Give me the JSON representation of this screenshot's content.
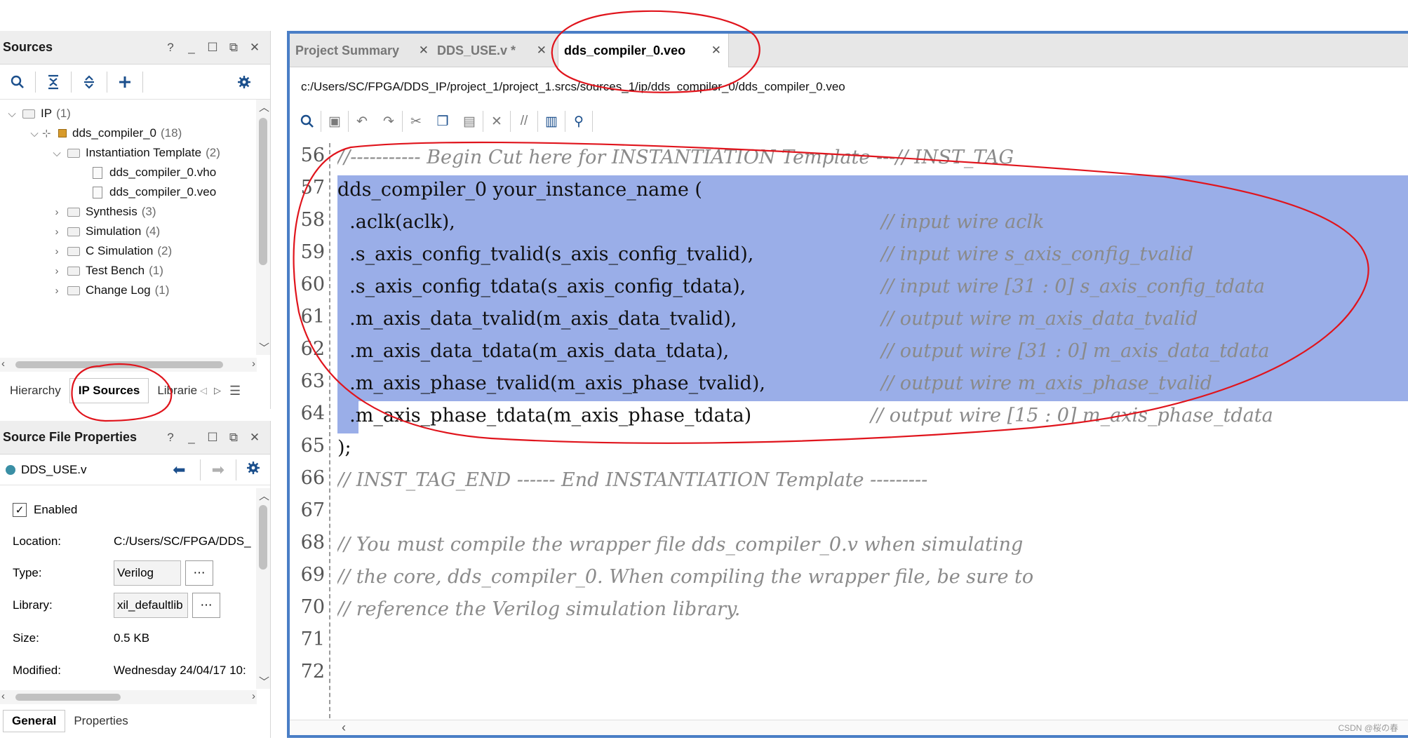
{
  "sources_panel": {
    "title": "Sources",
    "controls": [
      "?",
      "_",
      "☐",
      "⧉",
      "✕"
    ],
    "tree": [
      {
        "label": "IP",
        "count": "(1)"
      },
      {
        "label": "dds_compiler_0",
        "count": "(18)"
      },
      {
        "label": "Instantiation Template",
        "count": "(2)"
      },
      {
        "label": "dds_compiler_0.vho",
        "count": ""
      },
      {
        "label": "dds_compiler_0.veo",
        "count": ""
      },
      {
        "label": "Synthesis",
        "count": "(3)"
      },
      {
        "label": "Simulation",
        "count": "(4)"
      },
      {
        "label": "C Simulation",
        "count": "(2)"
      },
      {
        "label": "Test Bench",
        "count": "(1)"
      },
      {
        "label": "Change Log",
        "count": "(1)"
      }
    ],
    "tabs": [
      "Hierarchy",
      "IP Sources",
      "Librarie"
    ]
  },
  "properties_panel": {
    "title": "Source File Properties",
    "file": "DDS_USE.v",
    "enabled_label": "Enabled",
    "rows": [
      {
        "label": "Location:",
        "value": "C:/Users/SC/FPGA/DDS_"
      },
      {
        "label": "Type:",
        "value": "Verilog"
      },
      {
        "label": "Library:",
        "value": "xil_defaultlib"
      },
      {
        "label": "Size:",
        "value": "0.5 KB"
      },
      {
        "label": "Modified:",
        "value": "Wednesday 24/04/17 10:"
      }
    ],
    "tabs": [
      "General",
      "Properties"
    ]
  },
  "editor": {
    "tabs": [
      {
        "label": "Project Summary"
      },
      {
        "label": "DDS_USE.v *"
      },
      {
        "label": "dds_compiler_0.veo"
      }
    ],
    "path": "c:/Users/SC/FPGA/DDS_IP/project_1/project_1.srcs/sources_1/ip/dds_compiler_0/dds_compiler_0.veo",
    "lines": [
      {
        "num": "56",
        "code": "",
        "comment": "//----------- Begin Cut here for INSTANTIATION Template ---// INST_TAG"
      },
      {
        "num": "57",
        "code": "dds_compiler_0 your_instance_name (",
        "comment": ""
      },
      {
        "num": "58",
        "code": "  .aclk(aclk),",
        "comment": "// input wire aclk"
      },
      {
        "num": "59",
        "code": "  .s_axis_config_tvalid(s_axis_config_tvalid),",
        "comment": "// input wire s_axis_config_tvalid"
      },
      {
        "num": "60",
        "code": "  .s_axis_config_tdata(s_axis_config_tdata),",
        "comment": "// input wire [31 : 0] s_axis_config_tdata"
      },
      {
        "num": "61",
        "code": "  .m_axis_data_tvalid(m_axis_data_tvalid),",
        "comment": "// output wire m_axis_data_tvalid"
      },
      {
        "num": "62",
        "code": "  .m_axis_data_tdata(m_axis_data_tdata),",
        "comment": "// output wire [31 : 0] m_axis_data_tdata"
      },
      {
        "num": "63",
        "code": "  .m_axis_phase_tvalid(m_axis_phase_tvalid),",
        "comment": "// output wire m_axis_phase_tvalid"
      },
      {
        "num": "64",
        "code": "  .m_axis_phase_tdata(m_axis_phase_tdata)",
        "comment": "// output wire [15 : 0] m_axis_phase_tdata"
      },
      {
        "num": "65",
        "code": ");",
        "comment": ""
      },
      {
        "num": "66",
        "code": "",
        "comment": "// INST_TAG_END ------ End INSTANTIATION Template ---------"
      },
      {
        "num": "67",
        "code": "",
        "comment": ""
      },
      {
        "num": "68",
        "code": "",
        "comment": "// You must compile the wrapper file dds_compiler_0.v when simulating"
      },
      {
        "num": "69",
        "code": "",
        "comment": "// the core, dds_compiler_0. When compiling the wrapper file, be sure to"
      },
      {
        "num": "70",
        "code": "",
        "comment": "// reference the Verilog simulation library."
      },
      {
        "num": "71",
        "code": "",
        "comment": ""
      },
      {
        "num": "72",
        "code": "",
        "comment": ""
      }
    ]
  },
  "watermark": "CSDN @桜の春",
  "colors": {
    "selection": "#9aaee8",
    "editor_border": "#4a7ec6",
    "annotation": "#e0141c"
  }
}
